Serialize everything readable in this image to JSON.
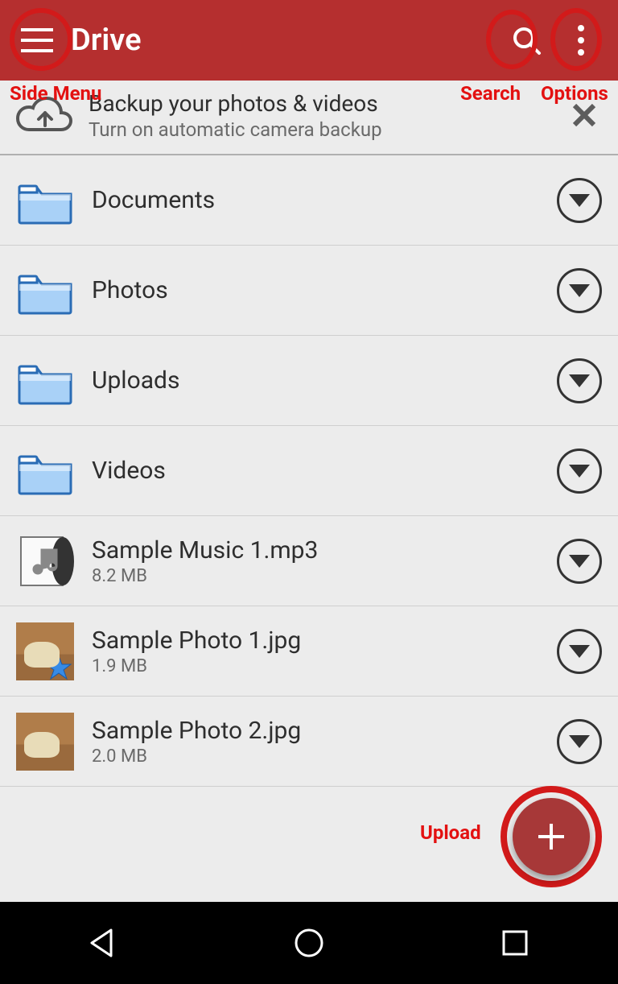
{
  "app_bar": {
    "title": "Drive"
  },
  "callouts": {
    "side_menu": "Side Menu",
    "search": "Search",
    "options": "Options",
    "upload": "Upload"
  },
  "banner": {
    "title": "Backup your photos & videos",
    "subtitle": "Turn on automatic camera backup"
  },
  "items": [
    {
      "name": "Documents",
      "type": "folder",
      "sub": ""
    },
    {
      "name": "Photos",
      "type": "folder",
      "sub": ""
    },
    {
      "name": "Uploads",
      "type": "folder",
      "sub": ""
    },
    {
      "name": "Videos",
      "type": "folder",
      "sub": ""
    },
    {
      "name": "Sample Music 1.mp3",
      "type": "audio",
      "sub": "8.2 MB"
    },
    {
      "name": "Sample Photo 1.jpg",
      "type": "image",
      "sub": "1.9 MB",
      "starred": true
    },
    {
      "name": "Sample Photo 2.jpg",
      "type": "image",
      "sub": "2.0 MB"
    }
  ]
}
